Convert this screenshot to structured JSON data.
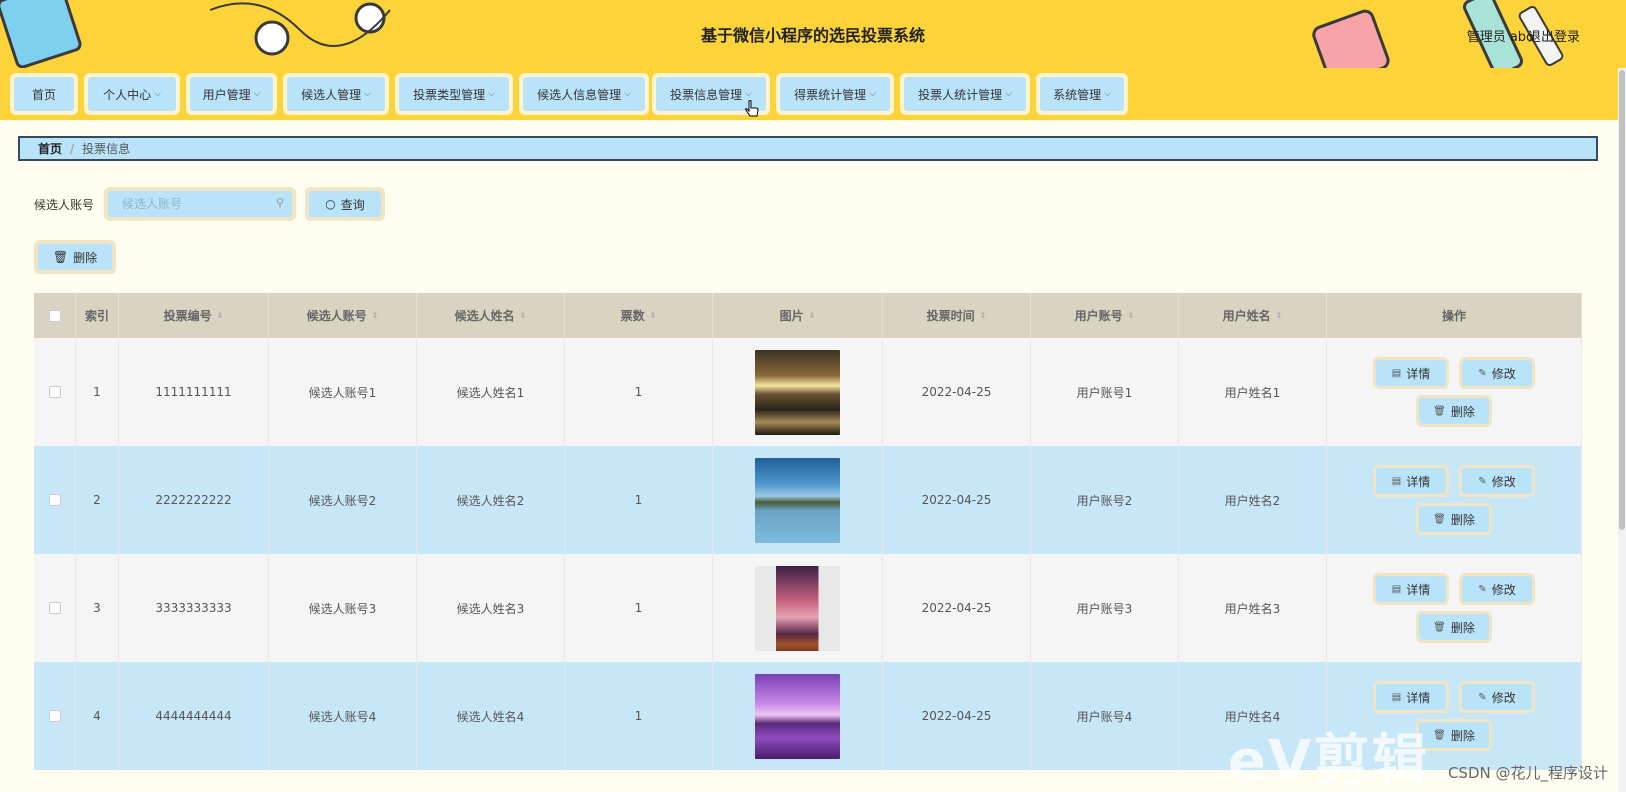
{
  "header": {
    "title": "基于微信小程序的选民投票系统",
    "user_info": "管理员 abo",
    "logout": "退出登录"
  },
  "nav": {
    "items": [
      {
        "label": "首页",
        "has_dropdown": false
      },
      {
        "label": "个人中心",
        "has_dropdown": true
      },
      {
        "label": "用户管理",
        "has_dropdown": true
      },
      {
        "label": "候选人管理",
        "has_dropdown": true
      },
      {
        "label": "投票类型管理",
        "has_dropdown": true
      },
      {
        "label": "候选人信息管理",
        "has_dropdown": true
      },
      {
        "label": "投票信息管理",
        "has_dropdown": true
      },
      {
        "label": "得票统计管理",
        "has_dropdown": true
      },
      {
        "label": "投票人统计管理",
        "has_dropdown": true
      },
      {
        "label": "系统管理",
        "has_dropdown": true
      }
    ]
  },
  "breadcrumb": {
    "home": "首页",
    "separator": "/",
    "current": "投票信息"
  },
  "search": {
    "label": "候选人账号",
    "placeholder": "候选人账号",
    "value": "",
    "button": "查询"
  },
  "toolbar": {
    "delete_label": "删除"
  },
  "table": {
    "headers": [
      "索引",
      "投票编号",
      "候选人账号",
      "候选人姓名",
      "票数",
      "图片",
      "投票时间",
      "用户账号",
      "用户姓名",
      "操作"
    ],
    "rows": [
      {
        "index": "1",
        "vote_no": "1111111111",
        "cand_account": "候选人账号1",
        "cand_name": "候选人姓名1",
        "votes": "1",
        "image": "sunset-beach",
        "time": "2022-04-25",
        "user_account": "用户账号1",
        "user_name": "用户姓名1"
      },
      {
        "index": "2",
        "vote_no": "2222222222",
        "cand_account": "候选人账号2",
        "cand_name": "候选人姓名2",
        "votes": "1",
        "image": "lake-mountains",
        "time": "2022-04-25",
        "user_account": "用户账号2",
        "user_name": "用户姓名2"
      },
      {
        "index": "3",
        "vote_no": "3333333333",
        "cand_account": "候选人账号3",
        "cand_name": "候选人姓名3",
        "votes": "1",
        "image": "pink-cloud-painting",
        "time": "2022-04-25",
        "user_account": "用户账号3",
        "user_name": "用户姓名3"
      },
      {
        "index": "4",
        "vote_no": "4444444444",
        "cand_account": "候选人账号4",
        "cand_name": "候选人姓名4",
        "votes": "1",
        "image": "purple-sea-sunset",
        "time": "2022-04-25",
        "user_account": "用户账号4",
        "user_name": "用户姓名4"
      }
    ],
    "actions": {
      "detail": "详情",
      "edit": "修改",
      "delete": "删除"
    }
  },
  "watermark": {
    "ev": "eV剪辑",
    "csdn": "CSDN @花儿_程序设计"
  },
  "colors": {
    "header_bg": "#fcd43a",
    "button_bg": "#b9e3f8",
    "row_highlight": "#c7e6f8"
  }
}
